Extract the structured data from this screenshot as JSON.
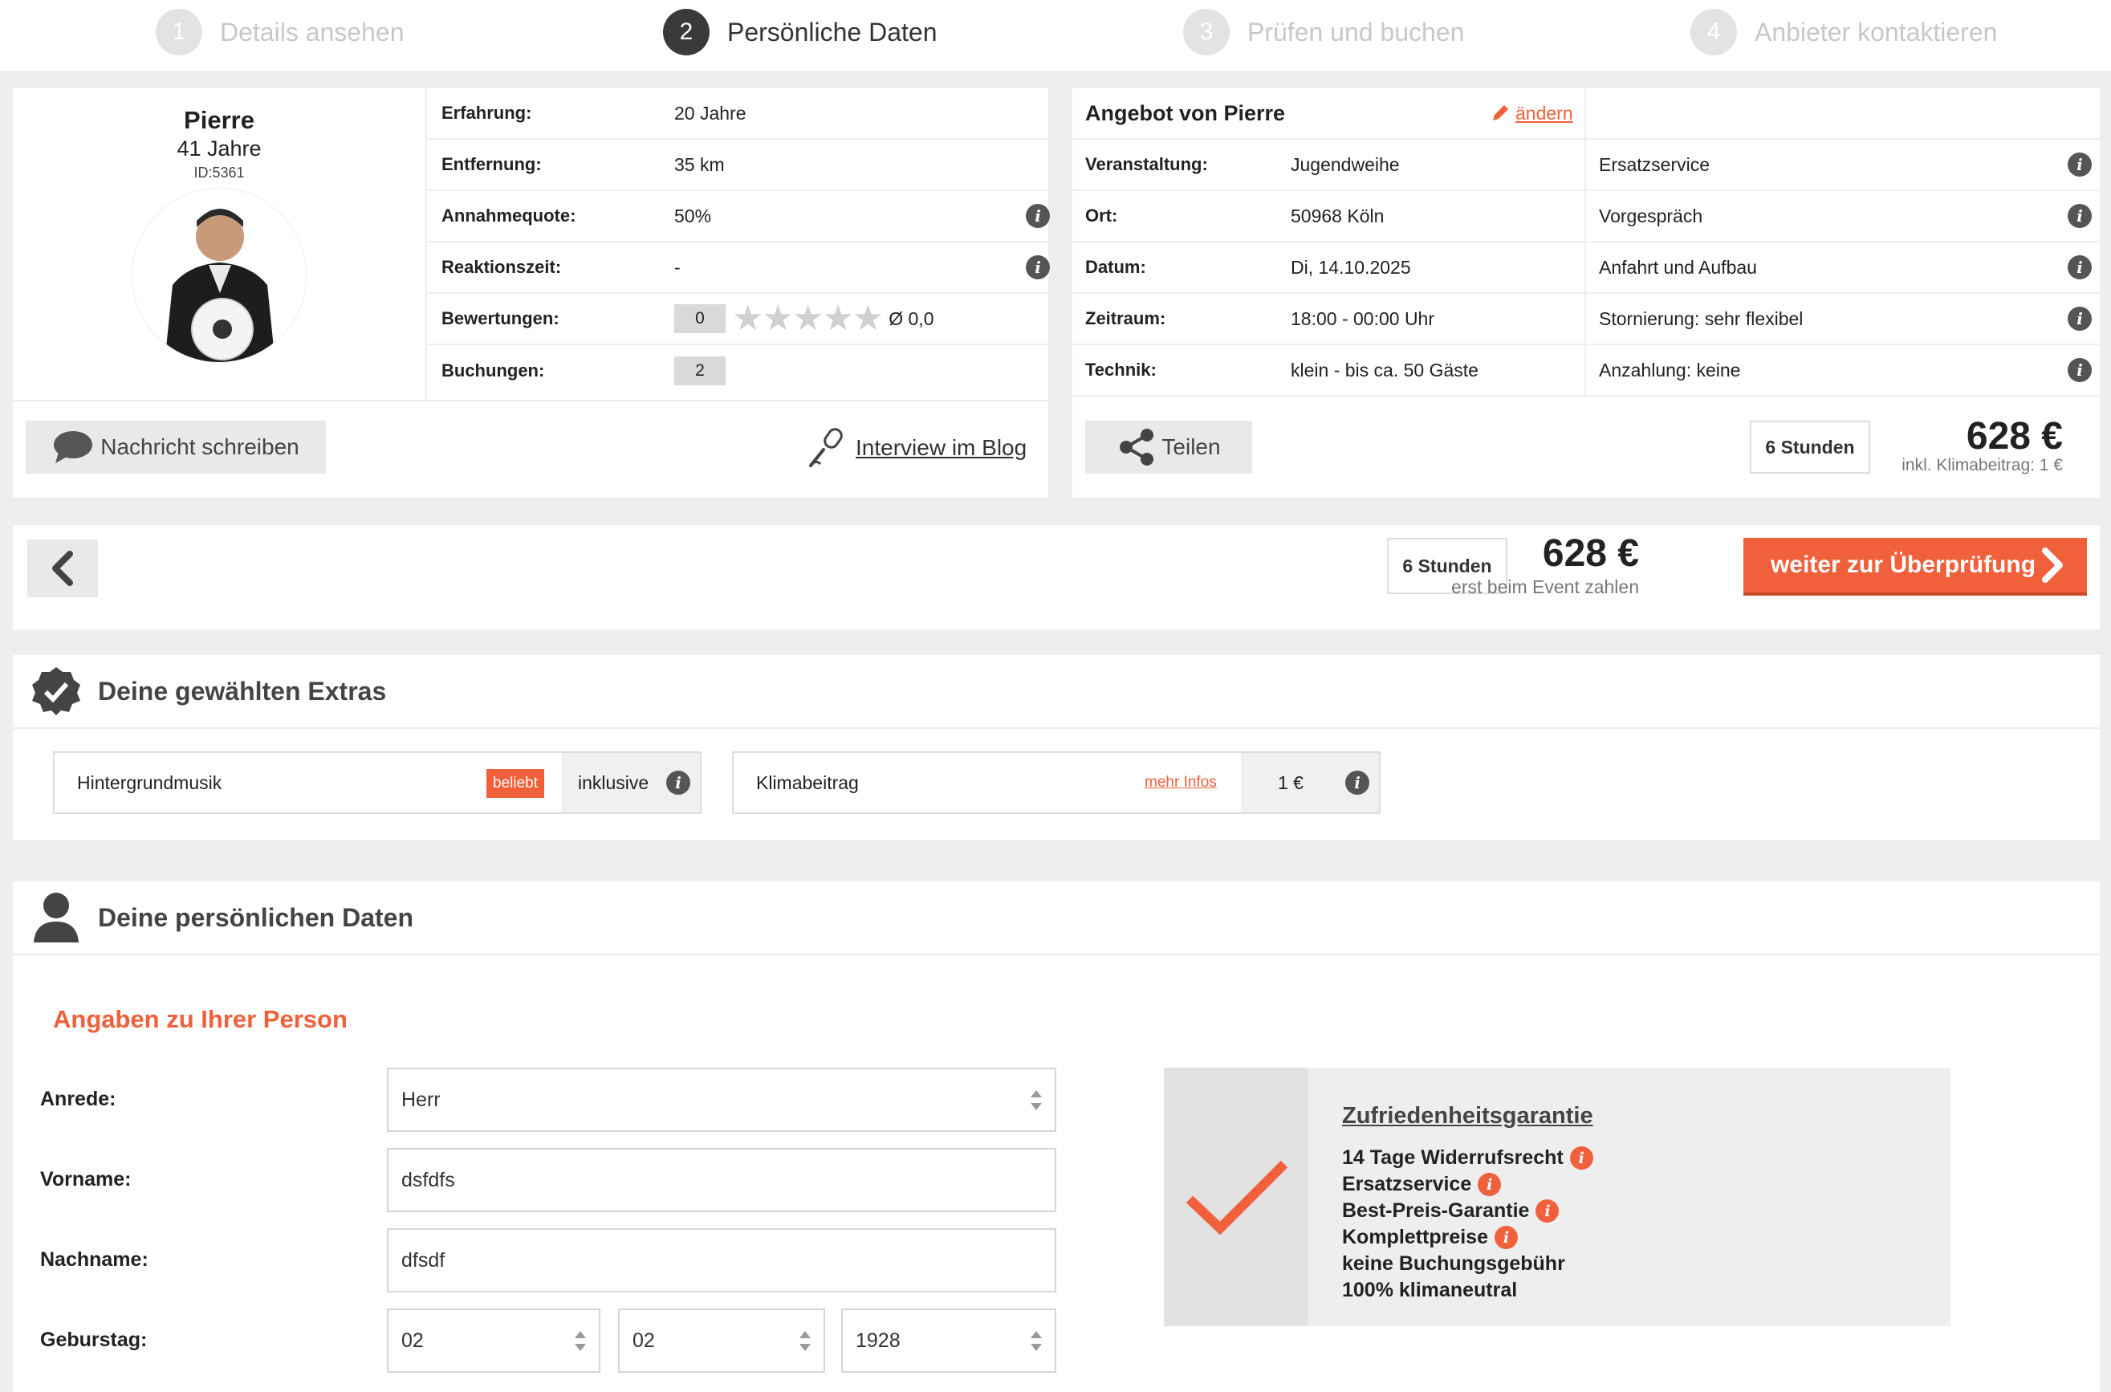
{
  "steps": [
    {
      "num": "1",
      "label": "Details ansehen"
    },
    {
      "num": "2",
      "label": "Persönliche Daten"
    },
    {
      "num": "3",
      "label": "Prüfen und buchen"
    },
    {
      "num": "4",
      "label": "Anbieter kontaktieren"
    }
  ],
  "provider": {
    "name": "Pierre",
    "age": "41 Jahre",
    "id": "ID:5361",
    "rows": [
      {
        "key": "Erfahrung:",
        "value": "20 Jahre"
      },
      {
        "key": "Entfernung:",
        "value": "35 km"
      },
      {
        "key": "Annahmequote:",
        "value": "50%"
      },
      {
        "key": "Reaktionszeit:",
        "value": "-"
      },
      {
        "key": "Bewertungen:",
        "count": "0",
        "stars": "★★★★★",
        "avg": "Ø 0,0"
      },
      {
        "key": "Buchungen:",
        "count": "2"
      }
    ],
    "message_button": "Nachricht schreiben",
    "blog_link": "Interview im Blog"
  },
  "offer": {
    "title": "Angebot von Pierre",
    "edit_link": "ändern",
    "rows": [
      {
        "key": "Veranstaltung:",
        "value": "Jugendweihe",
        "feature": "Ersatzservice"
      },
      {
        "key": "Ort:",
        "value": "50968 Köln",
        "feature": "Vorgespräch"
      },
      {
        "key": "Datum:",
        "value": "Di, 14.10.2025",
        "feature": "Anfahrt und Aufbau"
      },
      {
        "key": "Zeitraum:",
        "value": "18:00 - 00:00 Uhr",
        "feature": "Stornierung: sehr flexibel"
      },
      {
        "key": "Technik:",
        "value": "klein - bis ca. 50 Gäste",
        "feature": "Anzahlung: keine"
      }
    ],
    "share_button": "Teilen",
    "hours": "6 Stunden",
    "price": "628 €",
    "price_note": "inkl. Klimabeitrag: 1 €"
  },
  "nav_bar": {
    "hours": "6 Stunden",
    "price": "628 €",
    "price_note": "erst beim Event zahlen",
    "continue_button": "weiter zur Überprüfung"
  },
  "extras": {
    "title": "Deine gewählten Extras",
    "items": [
      {
        "name": "Hintergrundmusik",
        "badge": "beliebt",
        "value": "inklusive"
      },
      {
        "name": "Klimabeitrag",
        "link": "mehr Infos",
        "value": "1 €"
      }
    ]
  },
  "personal": {
    "title": "Deine persönlichen Daten",
    "subtitle": "Angaben zu Ihrer Person",
    "fields": {
      "anrede_label": "Anrede:",
      "anrede_value": "Herr",
      "vorname_label": "Vorname:",
      "vorname_value": "dsfdfs",
      "nachname_label": "Nachname:",
      "nachname_value": "dfsdf",
      "geburtstag_label": "Geburstag:",
      "day": "02",
      "month": "02",
      "year": "1928"
    }
  },
  "guarantee": {
    "title": "Zufriedenheitsgarantie",
    "items": [
      {
        "text": "14 Tage Widerrufsrecht",
        "info": true
      },
      {
        "text": "Ersatzservice",
        "info": true
      },
      {
        "text": "Best-Preis-Garantie",
        "info": true
      },
      {
        "text": "Komplettpreise",
        "info": true
      },
      {
        "text": "keine Buchungsgebühr",
        "info": false
      },
      {
        "text": "100% klimaneutral",
        "info": false
      }
    ]
  },
  "colors": {
    "accent": "#f0603a",
    "dark": "#3a3a3a"
  },
  "icons": {
    "info": "i"
  }
}
